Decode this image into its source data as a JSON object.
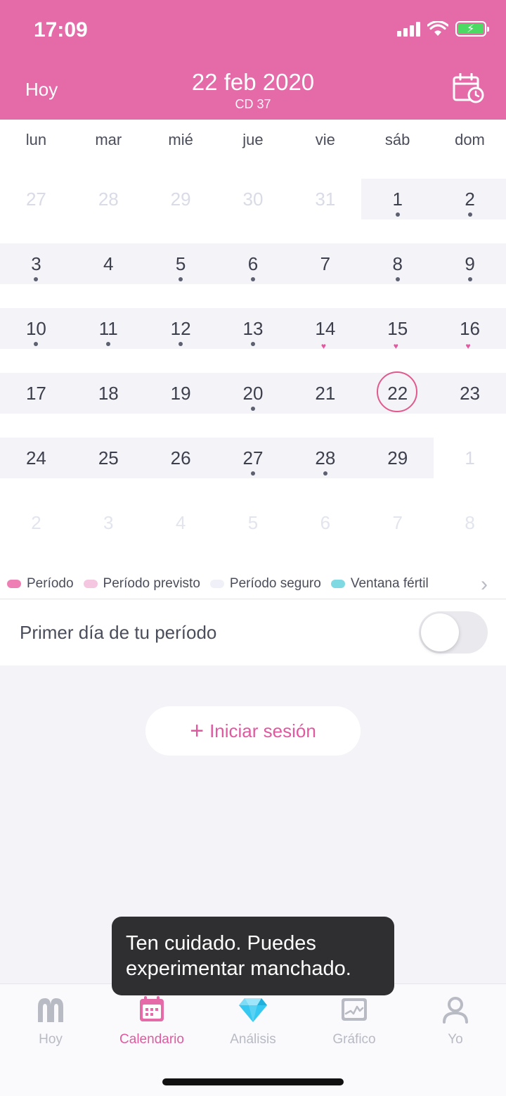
{
  "status_bar": {
    "time": "17:09"
  },
  "header": {
    "today_label": "Hoy",
    "date": "22 feb 2020",
    "cycle_day": "CD 37",
    "calendar_icon": "calendar-clock-icon"
  },
  "calendar": {
    "weekdays": [
      "lun",
      "mar",
      "mié",
      "jue",
      "vie",
      "sáb",
      "dom"
    ],
    "weeks": [
      [
        "27",
        "28",
        "29",
        "30",
        "31",
        "1",
        "2"
      ],
      [
        "3",
        "4",
        "5",
        "6",
        "7",
        "8",
        "9"
      ],
      [
        "10",
        "11",
        "12",
        "13",
        "14",
        "15",
        "16"
      ],
      [
        "17",
        "18",
        "19",
        "20",
        "21",
        "22",
        "23"
      ],
      [
        "24",
        "25",
        "26",
        "27",
        "28",
        "29",
        "1"
      ],
      [
        "2",
        "3",
        "4",
        "5",
        "6",
        "7",
        "8"
      ]
    ],
    "selected_day": "22"
  },
  "legend": {
    "items": [
      {
        "label": "Período",
        "color": "#ee7fb4"
      },
      {
        "label": "Período previsto",
        "color": "#f5c6df"
      },
      {
        "label": "Período seguro",
        "color": "#f0f1f8"
      },
      {
        "label": "Ventana fértil",
        "color": "#7fd9e3"
      }
    ]
  },
  "first_day": {
    "label": "Primer día de tu período",
    "toggle_on": false
  },
  "login": {
    "plus": "+",
    "label": "Iniciar sesión"
  },
  "toast": {
    "message": "Ten cuidado. Puedes experimentar manchado."
  },
  "tabs": [
    {
      "label": "Hoy",
      "icon": "home-arch-icon"
    },
    {
      "label": "Calendario",
      "icon": "calendar-icon",
      "active": true
    },
    {
      "label": "Análisis",
      "icon": "diamond-icon"
    },
    {
      "label": "Gráfico",
      "icon": "chart-icon"
    },
    {
      "label": "Yo",
      "icon": "profile-icon"
    }
  ],
  "colors": {
    "accent": "#e46aa8",
    "text": "#4a4d5a"
  }
}
